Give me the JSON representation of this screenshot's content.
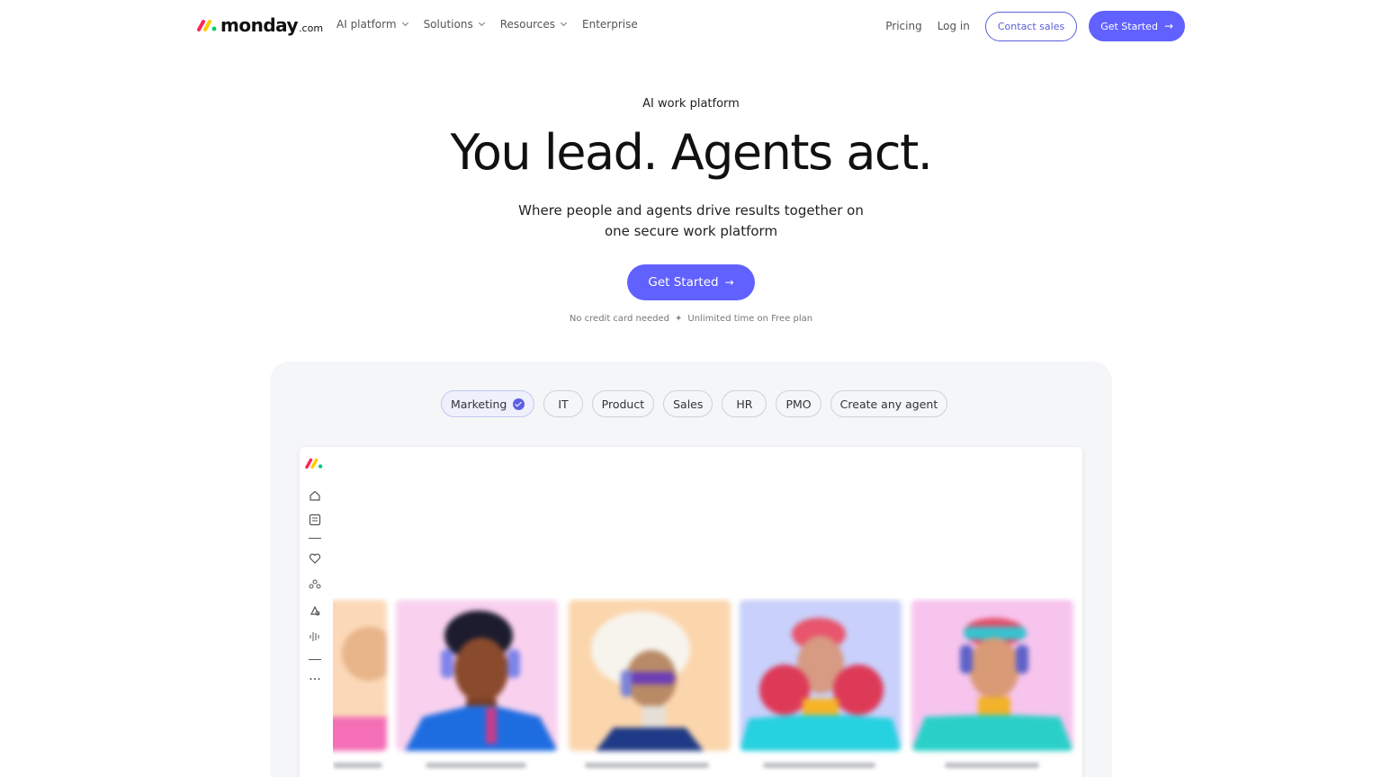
{
  "nav": {
    "logo_word": "monday",
    "logo_suffix": ".com",
    "links": [
      {
        "label": "AI platform",
        "dropdown": true
      },
      {
        "label": "Solutions",
        "dropdown": true
      },
      {
        "label": "Resources",
        "dropdown": true
      },
      {
        "label": "Enterprise",
        "dropdown": false
      }
    ],
    "pricing": "Pricing",
    "login": "Log in",
    "contact_sales": "Contact sales",
    "get_started": "Get Started"
  },
  "hero": {
    "eyebrow": "AI work platform",
    "headline": "You lead. Agents act.",
    "subline": "Where people and agents drive results together on one secure work platform",
    "cta": "Get Started",
    "fine_print_1": "No credit card needed",
    "fine_print_sep": "✦",
    "fine_print_2": "Unlimited time on Free plan"
  },
  "chips": [
    {
      "label": "Marketing",
      "selected": true
    },
    {
      "label": "IT",
      "selected": false
    },
    {
      "label": "Product",
      "selected": false
    },
    {
      "label": "Sales",
      "selected": false
    },
    {
      "label": "HR",
      "selected": false
    },
    {
      "label": "PMO",
      "selected": false
    },
    {
      "label": "Create any agent",
      "selected": false
    }
  ],
  "sidebar_icons": [
    "home-icon",
    "calendar-icon",
    "heart-icon",
    "team-icon",
    "apps-icon",
    "audio-icon",
    "more-icon"
  ],
  "colors": {
    "accent": "#6161ff",
    "logo_red": "#fb275d",
    "logo_yellow": "#ffcc00",
    "logo_green": "#00ca72",
    "panel_bg": "#f5f6f8",
    "card_bg_peach": "#fbd9b8",
    "card_bg_pink": "#f9d1ef",
    "card_bg_blue": "#c9d0fb"
  }
}
